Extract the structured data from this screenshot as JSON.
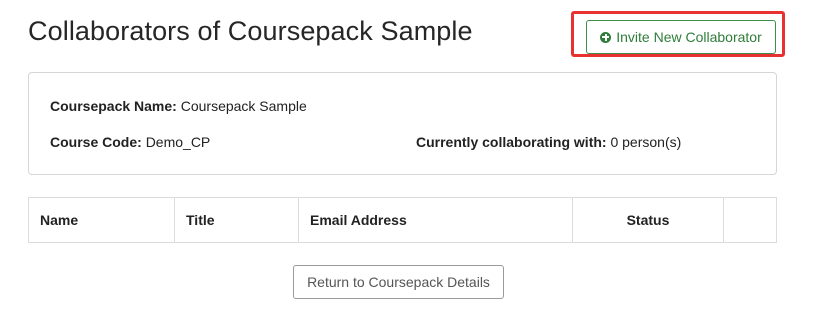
{
  "page": {
    "title": "Collaborators of Coursepack Sample"
  },
  "actions": {
    "invite_label": "Invite New Collaborator",
    "invite_icon": "plus-circle-icon",
    "return_label": "Return to Coursepack Details"
  },
  "colors": {
    "accent_green": "#2f7d39",
    "highlight_red": "#e8322f"
  },
  "info": {
    "name_label": "Coursepack Name:",
    "name_value": "Coursepack Sample",
    "code_label": "Course Code:",
    "code_value": "Demo_CP",
    "collab_label": "Currently collaborating with:",
    "collab_value": "0 person(s)"
  },
  "table": {
    "columns": [
      "Name",
      "Title",
      "Email Address",
      "Status",
      ""
    ],
    "rows": []
  }
}
